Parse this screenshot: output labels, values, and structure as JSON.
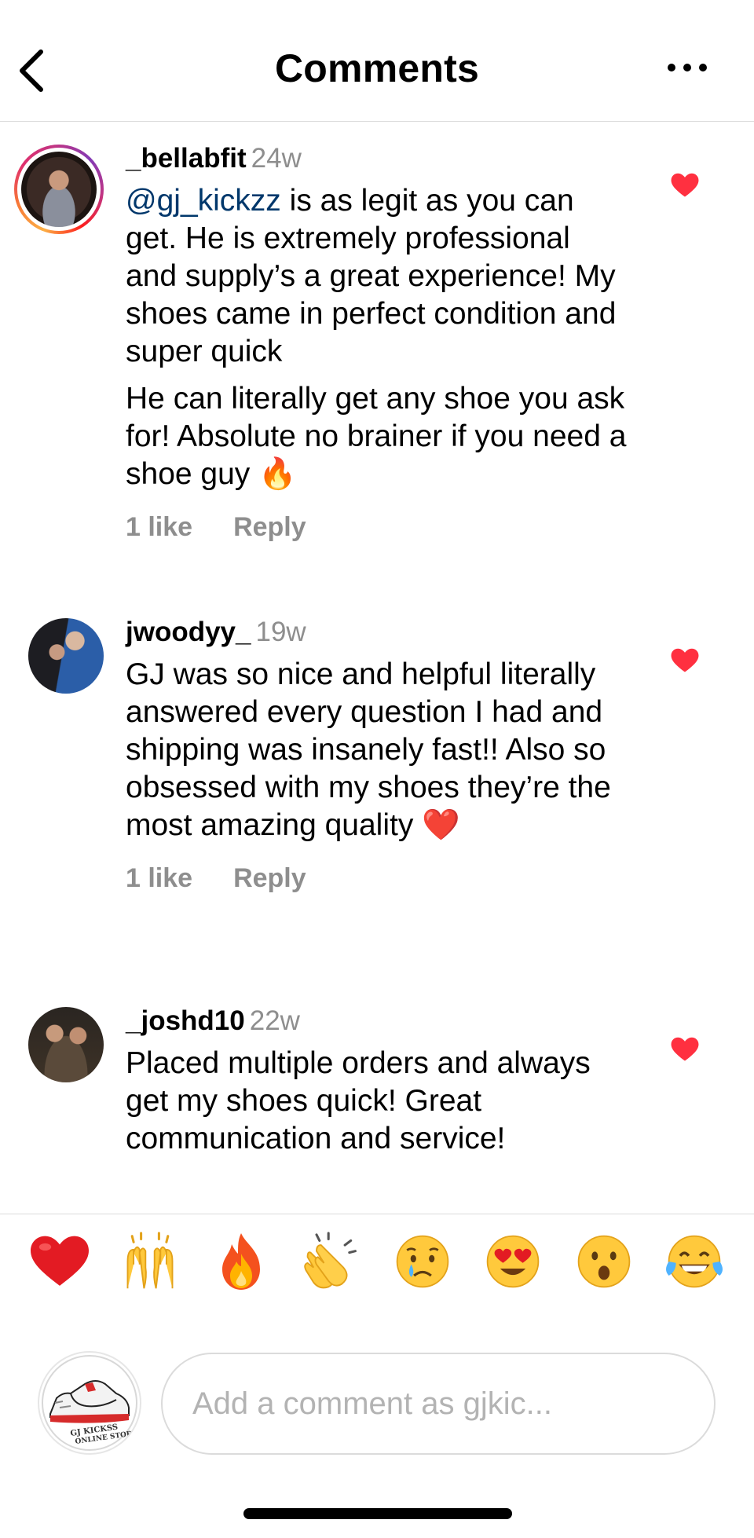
{
  "header": {
    "title": "Comments",
    "back_icon": "chevron-left-icon",
    "more_icon": "ellipsis-icon"
  },
  "comments": [
    {
      "username": "_bellabfit",
      "time": "24w",
      "mention": "@gj_kickzz",
      "text_after_mention": " is as legit as you can get. He is extremely professional and supply’s a great experience! My shoes came in perfect condition and super quick",
      "text_2": "He can literally get any shoe you ask for! Absolute no brainer if you need a shoe guy ",
      "emoji": "🔥",
      "likes": "1 like",
      "reply": "Reply",
      "liked": true
    },
    {
      "username": "jwoodyy_",
      "time": "19w",
      "text": "GJ was so nice and helpful literally answered every question I had and shipping was insanely fast!! Also so obsessed with my shoes they’re the most amazing quality ",
      "emoji": "❤️",
      "likes": "1 like",
      "reply": "Reply",
      "liked": true
    },
    {
      "username": "_joshd10",
      "time": "22w",
      "text": "Placed multiple orders and always get my shoes quick! Great communication and service!",
      "liked": true
    }
  ],
  "reactions": [
    "❤️",
    "🙌",
    "🔥",
    "👏",
    "😢",
    "😍",
    "😮",
    "😂"
  ],
  "composer": {
    "placeholder": "Add a comment as gjkic...",
    "avatar_line1": "GJ KICKSS",
    "avatar_line2": "ONLINE STORE"
  },
  "colors": {
    "accent_heart": "#ff3040",
    "mention": "#00376b",
    "secondary_text": "#8e8e8e",
    "divider": "#dbdbdb"
  }
}
